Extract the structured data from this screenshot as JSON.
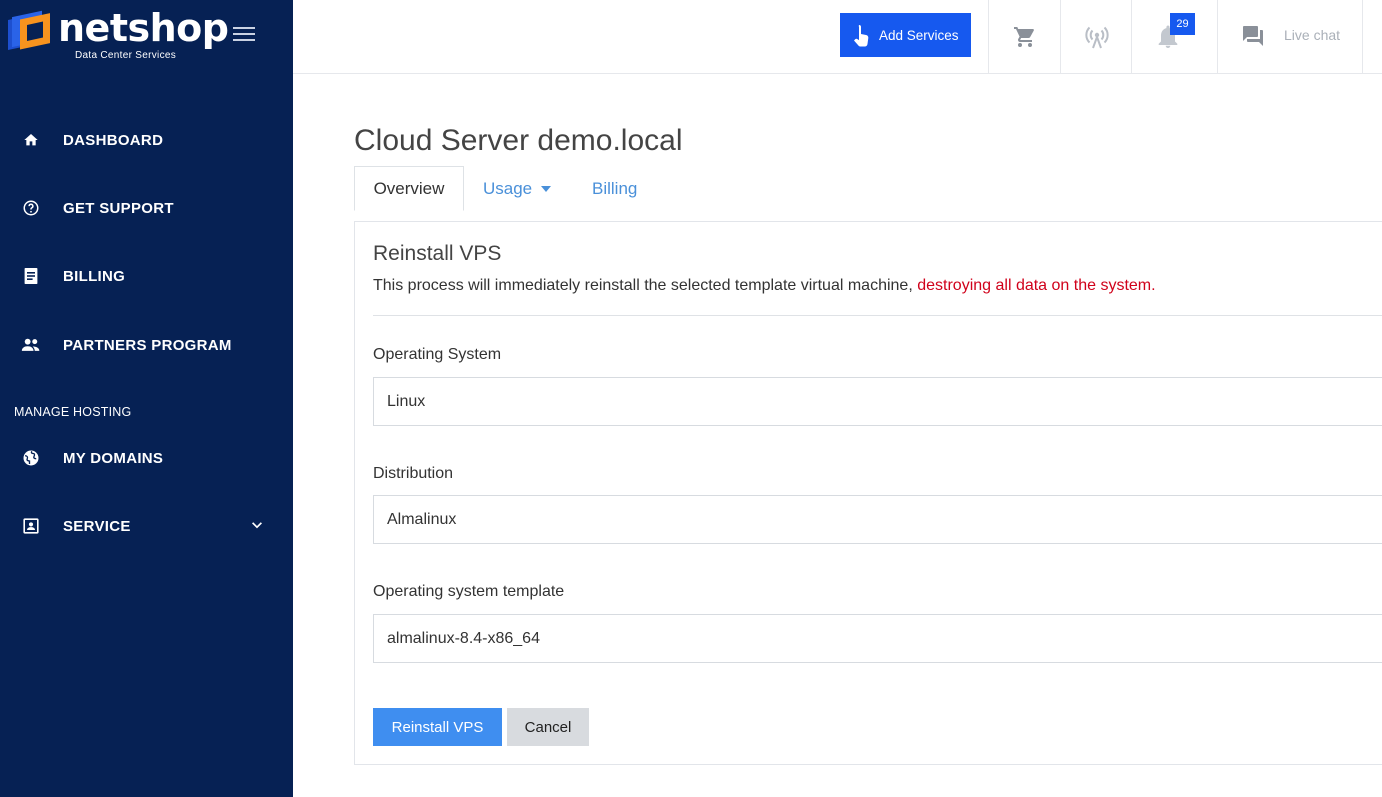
{
  "brand": {
    "name": "netshop",
    "tagline": "Data Center Services",
    "accent": "#1659ef",
    "sidebar_bg": "#062154",
    "logo_orange": "#f7931e"
  },
  "sidebar": {
    "items": [
      {
        "label": "DASHBOARD",
        "icon": "home-icon"
      },
      {
        "label": "GET SUPPORT",
        "icon": "help-circle-icon"
      },
      {
        "label": "BILLING",
        "icon": "receipt-icon"
      },
      {
        "label": "PARTNERS PROGRAM",
        "icon": "people-icon"
      }
    ],
    "section_label": "MANAGE HOSTING",
    "hosting_items": [
      {
        "label": "MY DOMAINS",
        "icon": "globe-icon"
      },
      {
        "label": "SERVICE",
        "icon": "contact-card-icon"
      }
    ]
  },
  "topbar": {
    "add_services_label": "Add Services",
    "notification_count": "29",
    "live_chat_label": "Live chat"
  },
  "page": {
    "title": "Cloud Server demo.local",
    "tabs": [
      {
        "label": "Overview",
        "active": true
      },
      {
        "label": "Usage",
        "active": false
      },
      {
        "label": "Billing",
        "active": false
      }
    ]
  },
  "reinstall": {
    "title": "Reinstall VPS",
    "description": "This process will immediately reinstall the selected template virtual machine, ",
    "description_warning": "destroying all data on the system.",
    "os_label": "Operating System",
    "os_value": "Linux",
    "distribution_label": "Distribution",
    "distribution_value": "Almalinux",
    "template_label": "Operating system template",
    "template_value": "almalinux-8.4-x86_64",
    "submit_label": "Reinstall VPS",
    "cancel_label": "Cancel"
  }
}
